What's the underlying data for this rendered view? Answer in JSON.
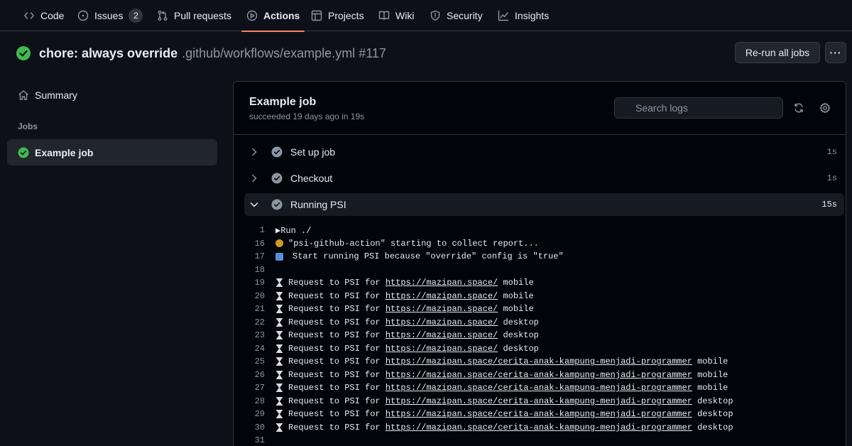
{
  "nav": {
    "tabs": [
      {
        "label": "Code",
        "icon": "code-icon"
      },
      {
        "label": "Issues",
        "icon": "issue-icon",
        "count": "2"
      },
      {
        "label": "Pull requests",
        "icon": "pull-request-icon"
      },
      {
        "label": "Actions",
        "icon": "play-icon",
        "active": true
      },
      {
        "label": "Projects",
        "icon": "table-icon"
      },
      {
        "label": "Wiki",
        "icon": "book-icon"
      },
      {
        "label": "Security",
        "icon": "shield-icon"
      },
      {
        "label": "Insights",
        "icon": "graph-icon"
      }
    ]
  },
  "header": {
    "title": "chore: always override",
    "workflow_path": ".github/workflows/example.yml",
    "run_number": "#117",
    "rerun_label": "Re-run all jobs",
    "more_label": "···"
  },
  "sidebar": {
    "summary_label": "Summary",
    "jobs_heading": "Jobs",
    "job_label": "Example job"
  },
  "job": {
    "title": "Example job",
    "subtitle": "succeeded 19 days ago in 19s",
    "search_placeholder": "Search logs",
    "steps": [
      {
        "label": "Set up job",
        "duration": "1s"
      },
      {
        "label": "Checkout",
        "duration": "1s"
      },
      {
        "label": "Running PSI",
        "duration": "15s"
      }
    ]
  },
  "logs": {
    "run": {
      "num": "1",
      "text": "▶Run ./"
    },
    "starting": {
      "num": "16",
      "text": "\"psi-github-action\" starting to collect report..."
    },
    "start_psi": {
      "num": "17",
      "text": "Start running PSI because \"override\" config is \"true\""
    },
    "blank1": {
      "num": "18"
    },
    "request_prefix": "Request to PSI for",
    "requests": [
      {
        "num": "19",
        "url": "https://mazipan.space/",
        "device": "mobile"
      },
      {
        "num": "20",
        "url": "https://mazipan.space/",
        "device": "mobile"
      },
      {
        "num": "21",
        "url": "https://mazipan.space/",
        "device": "mobile"
      },
      {
        "num": "22",
        "url": "https://mazipan.space/",
        "device": "desktop"
      },
      {
        "num": "23",
        "url": "https://mazipan.space/",
        "device": "desktop"
      },
      {
        "num": "24",
        "url": "https://mazipan.space/",
        "device": "desktop"
      },
      {
        "num": "25",
        "url": "https://mazipan.space/cerita-anak-kampung-menjadi-programmer",
        "device": "mobile"
      },
      {
        "num": "26",
        "url": "https://mazipan.space/cerita-anak-kampung-menjadi-programmer",
        "device": "mobile"
      },
      {
        "num": "27",
        "url": "https://mazipan.space/cerita-anak-kampung-menjadi-programmer",
        "device": "mobile"
      },
      {
        "num": "28",
        "url": "https://mazipan.space/cerita-anak-kampung-menjadi-programmer",
        "device": "desktop"
      },
      {
        "num": "29",
        "url": "https://mazipan.space/cerita-anak-kampung-menjadi-programmer",
        "device": "desktop"
      },
      {
        "num": "30",
        "url": "https://mazipan.space/cerita-anak-kampung-menjadi-programmer",
        "device": "desktop"
      }
    ],
    "blank2": {
      "num": "31"
    }
  },
  "colors": {
    "success": "#3fb950",
    "accent_underline": "#f78166",
    "log_yellow": "#d29922",
    "log_green": "#3fb950"
  }
}
